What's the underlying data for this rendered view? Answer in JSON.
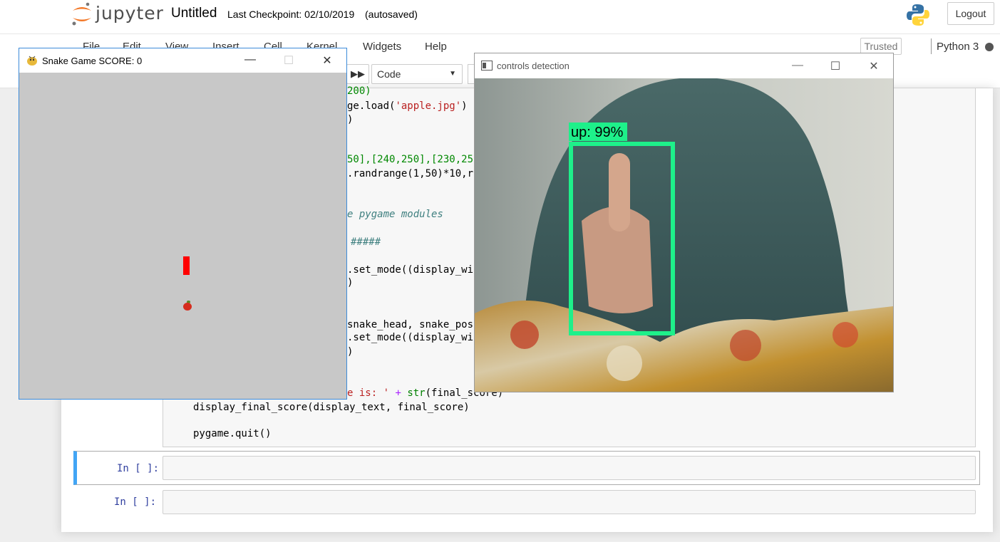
{
  "header": {
    "logo_text": "jupyter",
    "notebook_title": "Untitled",
    "checkpoint": "Last Checkpoint: 02/10/2019",
    "autosave": "(autosaved)",
    "logout_label": "Logout"
  },
  "menubar": {
    "items": [
      "File",
      "Edit",
      "View",
      "Insert",
      "Cell",
      "Kernel",
      "Widgets",
      "Help"
    ],
    "trusted_label": "Trusted",
    "kernel_name": "Python 3"
  },
  "toolbar": {
    "cell_type": "Code"
  },
  "code": {
    "lines": [
      {
        "before": "200)",
        "str": "",
        "after": ""
      },
      {
        "before": "ge.load(",
        "str": "'apple.jpg'",
        "after": ")"
      },
      {
        "before": ")",
        "str": "",
        "after": ""
      }
    ],
    "line_list": "50],[240,250],[230,25",
    "line_rand": ".randrange(1,50)*10,r",
    "comment_modules": "e pygame modules",
    "comment_hashes": "#####",
    "set_mode_1": ".set_mode((display_wi",
    "close_paren_1": ")",
    "snake_head": "snake_head, snake_pos",
    "set_mode_2": ".set_mode((display_wi",
    "close_paren_2": ")",
    "score_str_prefix": "e is: ",
    "score_plus": "+",
    "score_str_fn": "str",
    "score_str_suffix": "(final_score)",
    "display_final": "display_final_score(display_text, final_score)",
    "pygame_quit": "pygame.quit()"
  },
  "cells": [
    {
      "prompt": "In [ ]:"
    },
    {
      "prompt": "In [ ]:"
    }
  ],
  "snake_window": {
    "title": "Snake Game  SCORE: 0",
    "minimize": "—",
    "maximize": "☐",
    "close": "✕"
  },
  "camera_window": {
    "title": "controls detection",
    "minimize": "—",
    "maximize": "☐",
    "close": "✕",
    "detection_label": "up: 99%",
    "detection_color": "#1ef08a"
  },
  "colors": {
    "accent": "#42a5f5",
    "snake": "#ff0000",
    "game_bg": "#c8c8c8"
  }
}
